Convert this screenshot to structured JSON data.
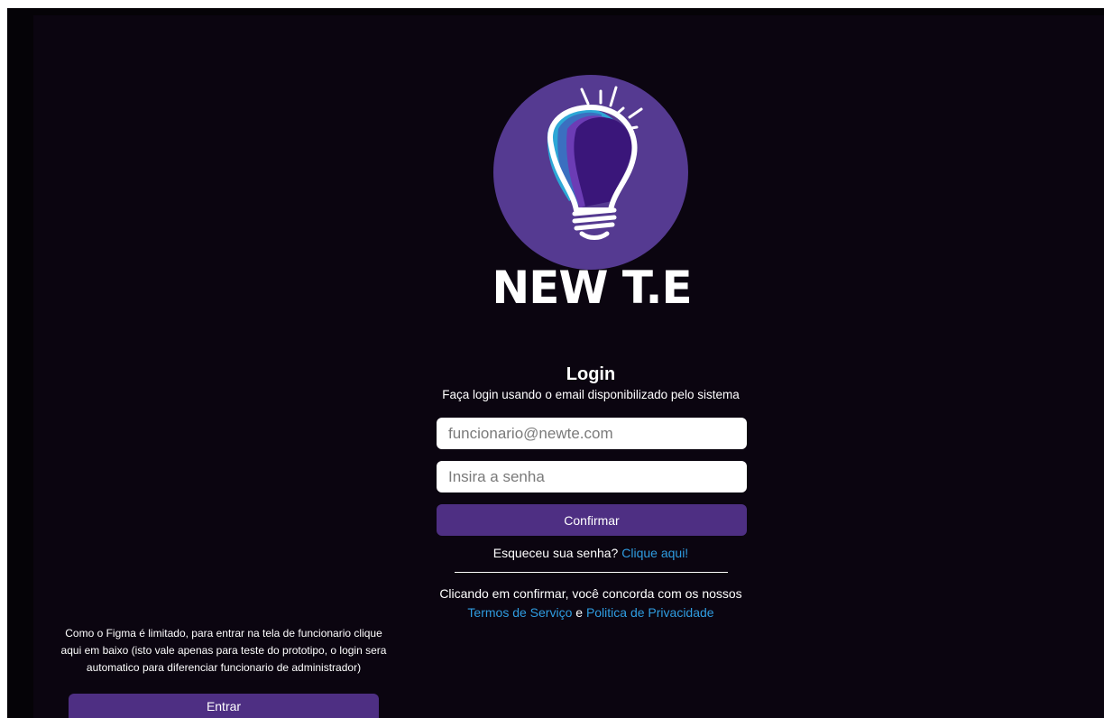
{
  "brand": {
    "name": "NEW T.E",
    "logo_icon": "lightbulb-icon",
    "circle_color": "#553a91"
  },
  "login": {
    "title": "Login",
    "subtitle": "Faça login usando o email disponibilizado pelo sistema",
    "email_placeholder": "funcionario@newte.com",
    "password_placeholder": "Insira a senha",
    "confirm_label": "Confirmar",
    "forgot_text": "Esqueceu sua senha?",
    "forgot_link": "Clique aqui!",
    "terms_text": "Clicando em confirmar, você concorda com os nossos",
    "terms_link": "Termos de Serviço",
    "terms_and": "e",
    "privacy_link": "Politica de Privacidade"
  },
  "prototype_note": {
    "text": "Como o Figma é limitado, para entrar na tela de funcionario clique aqui em baixo (isto vale apenas para teste do prototipo, o login sera automatico para diferenciar funcionario de administrador)",
    "button_label": "Entrar"
  },
  "colors": {
    "background": "#0b0510",
    "button": "#4e2f83",
    "link": "#2f9ce0"
  }
}
